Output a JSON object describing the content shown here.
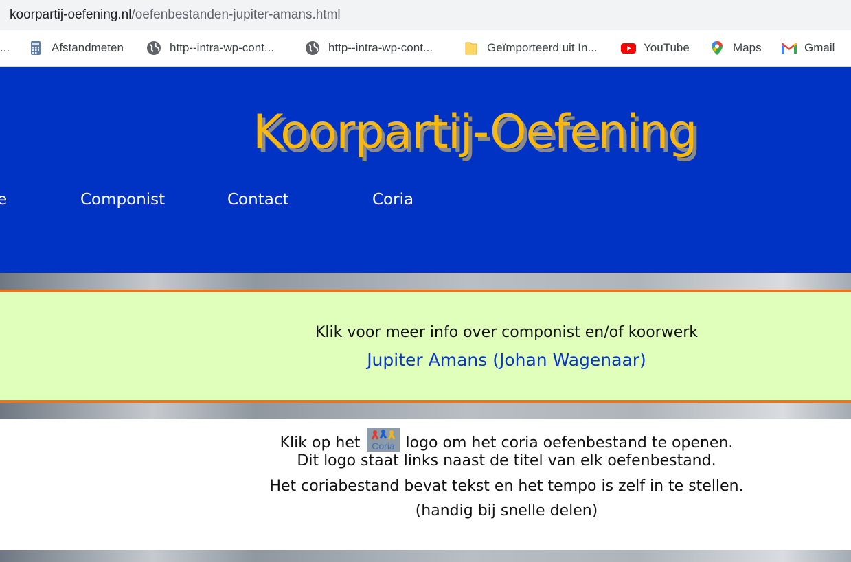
{
  "browser": {
    "url_domain": "koorpartij-oefening.nl",
    "url_path": "/oefenbestanden-jupiter-amans.html",
    "bookmarks": [
      {
        "label": "...",
        "icon": "overflow"
      },
      {
        "label": "Afstandmeten",
        "icon": "calculator-icon"
      },
      {
        "label": "http--intra-wp-cont...",
        "icon": "globe-icon"
      },
      {
        "label": "http--intra-wp-cont...",
        "icon": "globe-icon"
      },
      {
        "label": "Geïmporteerd uit In...",
        "icon": "folder-icon"
      },
      {
        "label": "YouTube",
        "icon": "youtube-icon"
      },
      {
        "label": "Maps",
        "icon": "maps-pin-icon"
      },
      {
        "label": "Gmail",
        "icon": "gmail-icon"
      }
    ]
  },
  "header": {
    "title": "Koorpartij-Oefening",
    "nav": [
      {
        "label": "e"
      },
      {
        "label": "Componist"
      },
      {
        "label": "Contact"
      },
      {
        "label": "Coria"
      }
    ]
  },
  "info": {
    "prompt": "Klik voor meer info over componist en/of koorwerk",
    "link": "Jupiter Amans (Johan Wagenaar)"
  },
  "instructions": {
    "line1_before": "Klik op het",
    "logo_text": "Coria",
    "line1_after": "logo om het coria oefenbestand te openen.",
    "line2": "Dit logo staat links naast de titel van elk oefenbestand.",
    "line3": "Het coriabestand bevat tekst en het tempo is zelf in te stellen.",
    "line4": "(handig bij snelle delen)"
  },
  "colors": {
    "header_bg": "#0033c4",
    "title": "#f9b80f",
    "info_bg": "#dfffbb",
    "info_border": "#e8761e",
    "link": "#0a36c7"
  }
}
